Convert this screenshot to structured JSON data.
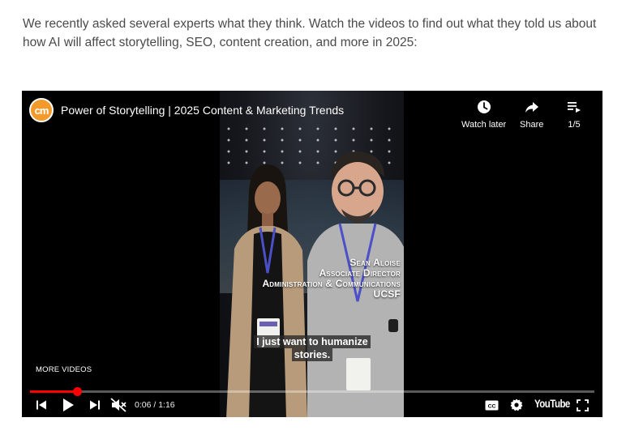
{
  "article": {
    "intro_text": "We recently asked several experts what they think. Watch the videos to find out what they told us about how AI will affect storytelling, SEO, content creation, and more in 2025:"
  },
  "player": {
    "logo_text": "cm",
    "title": "Power of Storytelling | 2025 Content & Marketing Trends",
    "actions": {
      "watch_later": "Watch later",
      "share": "Share",
      "playlist_count": "1/5"
    },
    "name_overlay": [
      "Sean Aloise",
      "Associate Director",
      "Administration & Communications",
      "UCSF"
    ],
    "caption_lines": [
      "I just want to humanize",
      "stories."
    ],
    "more_videos": "MORE VIDEOS",
    "time_display": "0:06 / 1:16",
    "progress_fraction": 0.083,
    "youtube_wordmark": "YouTube",
    "colors": {
      "progress": "#ff0000",
      "logo": "#f39a2b"
    }
  }
}
